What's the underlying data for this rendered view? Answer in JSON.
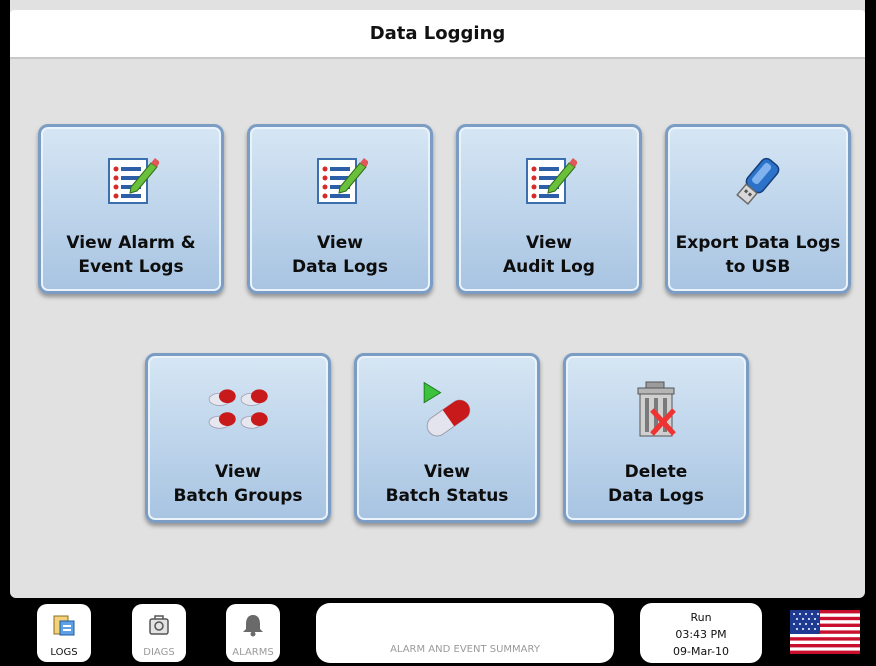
{
  "header": {
    "title": "Data Logging"
  },
  "tiles": [
    {
      "label": "View Alarm &\nEvent Logs",
      "icon": "log-list-icon"
    },
    {
      "label": "View\nData Logs",
      "icon": "log-list-icon"
    },
    {
      "label": "View\nAudit Log",
      "icon": "log-list-icon"
    },
    {
      "label": "Export Data Logs\nto USB",
      "icon": "usb-drive-icon"
    },
    {
      "label": "View\nBatch Groups",
      "icon": "batch-groups-icon"
    },
    {
      "label": "View\nBatch Status",
      "icon": "batch-status-icon"
    },
    {
      "label": "Delete\nData Logs",
      "icon": "delete-trash-icon"
    }
  ],
  "taskbar": {
    "logs_label": "LOGS",
    "diags_label": "DIAGS",
    "alarms_label": "ALARMS",
    "summary_label": "ALARM AND EVENT SUMMARY",
    "status": {
      "mode": "Run",
      "time": "03:43 PM",
      "date": "09-Mar-10"
    },
    "language": "us-flag-icon"
  },
  "colors": {
    "tile_border": "#7b9dc4",
    "tile_fill": "#bcd3ea",
    "background": "#e1e1e1",
    "disabled_text": "#9a9a9a"
  }
}
